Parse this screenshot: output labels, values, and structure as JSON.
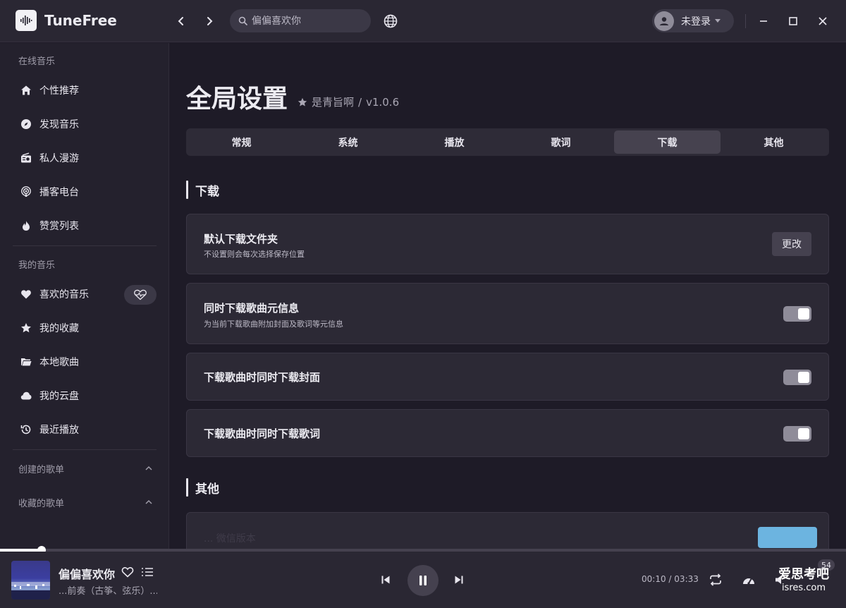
{
  "app": {
    "name": "TuneFree"
  },
  "search": {
    "placeholder": "偏偏喜欢你"
  },
  "user": {
    "name": "未登录"
  },
  "sidebar": {
    "sections": [
      "在线音乐",
      "我的音乐"
    ],
    "online": [
      {
        "label": "个性推荐",
        "icon": "home-icon"
      },
      {
        "label": "发现音乐",
        "icon": "disc-icon"
      },
      {
        "label": "私人漫游",
        "icon": "radio-icon"
      },
      {
        "label": "播客电台",
        "icon": "podcast-icon"
      },
      {
        "label": "赞赏列表",
        "icon": "flame-icon"
      }
    ],
    "mine": [
      {
        "label": "喜欢的音乐",
        "icon": "heart-icon"
      },
      {
        "label": "我的收藏",
        "icon": "star-icon"
      },
      {
        "label": "本地歌曲",
        "icon": "folder-icon"
      },
      {
        "label": "我的云盘",
        "icon": "cloud-icon"
      },
      {
        "label": "最近播放",
        "icon": "history-icon"
      }
    ],
    "created_playlists": "创建的歌单",
    "collected_playlists": "收藏的歌单"
  },
  "settings": {
    "title": "全局设置",
    "author": "是青旨啊",
    "separator": "/",
    "version": "v1.0.6",
    "tabs": [
      "常规",
      "系统",
      "播放",
      "歌词",
      "下载",
      "其他"
    ],
    "active_tab": "下载",
    "download_section": "下载",
    "other_section": "其他",
    "items": {
      "folder": {
        "title": "默认下载文件夹",
        "desc": "不设置则会每次选择保存位置",
        "button": "更改"
      },
      "meta": {
        "title": "同时下载歌曲元信息",
        "desc": "为当前下载歌曲附加封面及歌词等元信息",
        "enabled": true
      },
      "cover": {
        "title": "下载歌曲时同时下载封面",
        "enabled": true
      },
      "lyric": {
        "title": "下载歌曲时同时下载歌词",
        "enabled": true
      }
    },
    "other_partial_text": "... 微信版本"
  },
  "player": {
    "song_title": "偏偏喜欢你",
    "song_sub": "...前奏（古筝、弦乐）...",
    "current_time": "00:10",
    "time_sep": "/",
    "duration": "03:33",
    "progress": 0.05,
    "volume": "54",
    "watermark_line1": "爱思考吧",
    "watermark_line2": "isres.com"
  }
}
